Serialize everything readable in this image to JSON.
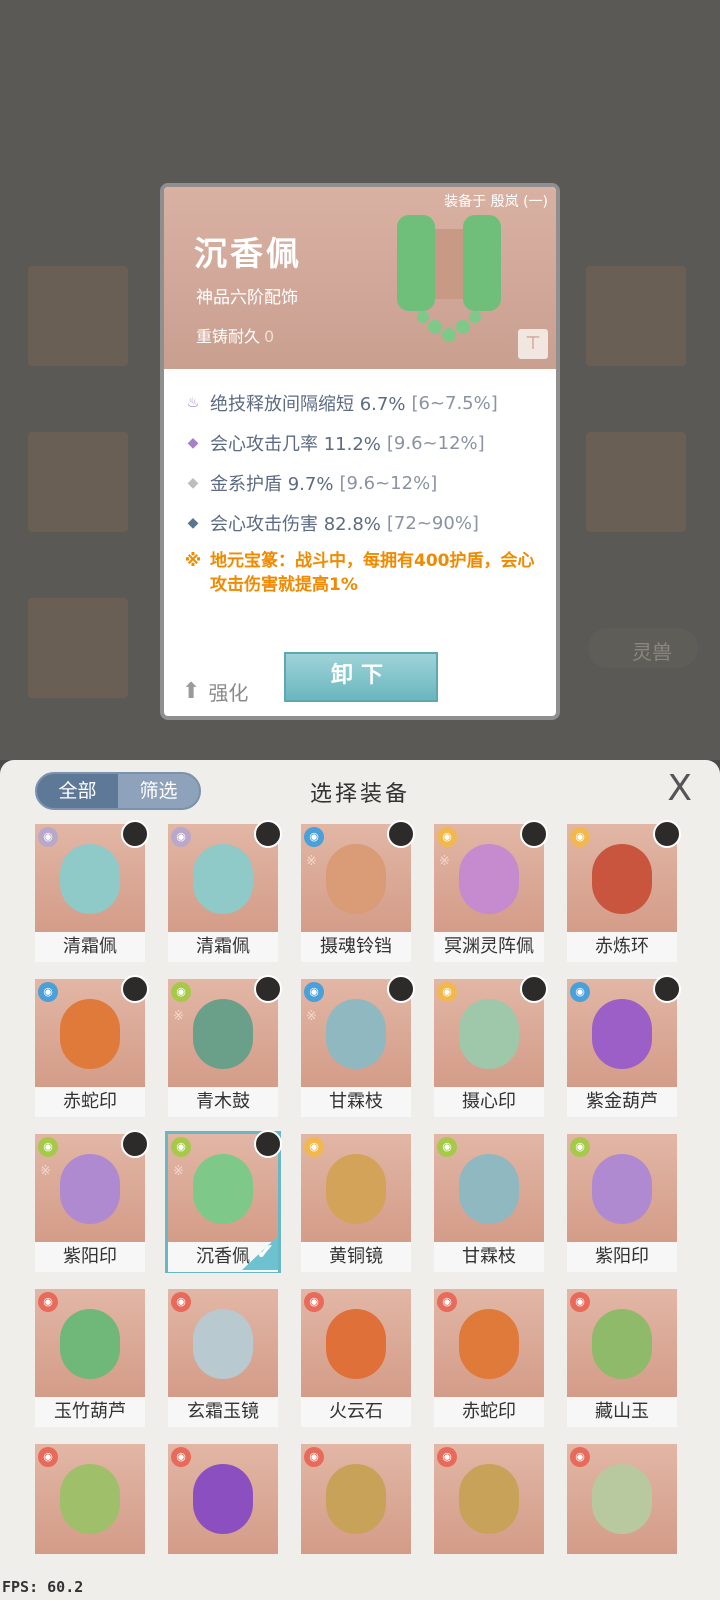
{
  "card": {
    "equipped_text": "装备于 殷岚 (一)",
    "name": "沉香佩",
    "grade": "神品六阶配饰",
    "durability_label": "重铸耐久",
    "durability_value": "0",
    "stats": [
      {
        "icon": "flame-icon",
        "label": "绝技释放间隔缩短 6.7%",
        "range": "[6~7.5%]",
        "color": "#9b7bc9"
      },
      {
        "icon": "diamond-purple-icon",
        "label": "会心攻击几率 11.2%",
        "range": "[9.6~12%]",
        "color": "#a880c8"
      },
      {
        "icon": "diamond-grey-icon",
        "label": "金系护盾 9.7%",
        "range": "[9.6~12%]",
        "color": "#bdbdbd"
      },
      {
        "icon": "diamond-blue-icon",
        "label": "会心攻击伤害 82.8%",
        "range": "[72~90%]",
        "color": "#5a7590"
      }
    ],
    "special": "地元宝篆：战斗中，每拥有400护盾，会心攻击伤害就提高1%",
    "upgrade_label": "强化",
    "unequip_label": "卸下"
  },
  "background": {
    "beast_label": "灵兽"
  },
  "panel": {
    "tab_all": "全部",
    "tab_filter": "筛选",
    "title": "选择装备",
    "close": "X"
  },
  "items": [
    {
      "name": "清霜佩",
      "elem": "#b9a8c9",
      "obj": "#8fc9c8",
      "avatar": true,
      "mark": false
    },
    {
      "name": "清霜佩",
      "elem": "#b9a8c9",
      "obj": "#8fc9c8",
      "avatar": true,
      "mark": false
    },
    {
      "name": "摄魂铃铛",
      "elem": "#4aa0d8",
      "obj": "#d99c77",
      "avatar": true,
      "mark": true
    },
    {
      "name": "冥渊灵阵佩",
      "elem": "#f0b84d",
      "obj": "#c68acf",
      "avatar": true,
      "mark": true
    },
    {
      "name": "赤炼环",
      "elem": "#f0b84d",
      "obj": "#c9553e",
      "avatar": true,
      "mark": false
    },
    {
      "name": "赤蛇印",
      "elem": "#4aa0d8",
      "obj": "#e07a3a",
      "avatar": true,
      "mark": false
    },
    {
      "name": "青木鼓",
      "elem": "#a6c94a",
      "obj": "#6aa08a",
      "avatar": true,
      "mark": true
    },
    {
      "name": "甘霖枝",
      "elem": "#4aa0d8",
      "obj": "#8fb8c0",
      "avatar": true,
      "mark": true
    },
    {
      "name": "摄心印",
      "elem": "#f0b84d",
      "obj": "#9fc7a9",
      "avatar": true,
      "mark": false
    },
    {
      "name": "紫金葫芦",
      "elem": "#4aa0d8",
      "obj": "#9b5fc7",
      "avatar": true,
      "mark": false
    },
    {
      "name": "紫阳印",
      "elem": "#a6c94a",
      "obj": "#b08ad0",
      "avatar": true,
      "mark": true
    },
    {
      "name": "沉香佩",
      "elem": "#a6c94a",
      "obj": "#7ec98a",
      "avatar": true,
      "mark": true,
      "selected": true
    },
    {
      "name": "黄铜镜",
      "elem": "#f0b84d",
      "obj": "#d4a35a",
      "avatar": false,
      "mark": false
    },
    {
      "name": "甘霖枝",
      "elem": "#a6c94a",
      "obj": "#8fb8c0",
      "avatar": false,
      "mark": false
    },
    {
      "name": "紫阳印",
      "elem": "#a6c94a",
      "obj": "#b08ad0",
      "avatar": false,
      "mark": false
    },
    {
      "name": "玉竹葫芦",
      "elem": "#e86a5a",
      "obj": "#6fb87a",
      "avatar": false,
      "mark": false
    },
    {
      "name": "玄霜玉镜",
      "elem": "#e86a5a",
      "obj": "#b8c9d0",
      "avatar": false,
      "mark": false
    },
    {
      "name": "火云石",
      "elem": "#e86a5a",
      "obj": "#e0703a",
      "avatar": false,
      "mark": false
    },
    {
      "name": "赤蛇印",
      "elem": "#e86a5a",
      "obj": "#e07a3a",
      "avatar": false,
      "mark": false
    },
    {
      "name": "藏山玉",
      "elem": "#e86a5a",
      "obj": "#8fba6a",
      "avatar": false,
      "mark": false
    },
    {
      "name": "",
      "elem": "#e86a5a",
      "obj": "#9fbf6a",
      "avatar": false,
      "mark": false
    },
    {
      "name": "",
      "elem": "#e86a5a",
      "obj": "#8b4fc0",
      "avatar": false,
      "mark": false
    },
    {
      "name": "",
      "elem": "#e86a5a",
      "obj": "#c9a25a",
      "avatar": false,
      "mark": false
    },
    {
      "name": "",
      "elem": "#e86a5a",
      "obj": "#c9a25a",
      "avatar": false,
      "mark": false
    },
    {
      "name": "",
      "elem": "#e86a5a",
      "obj": "#b8c9a0",
      "avatar": false,
      "mark": false
    }
  ],
  "fps": "FPS: 60.2"
}
